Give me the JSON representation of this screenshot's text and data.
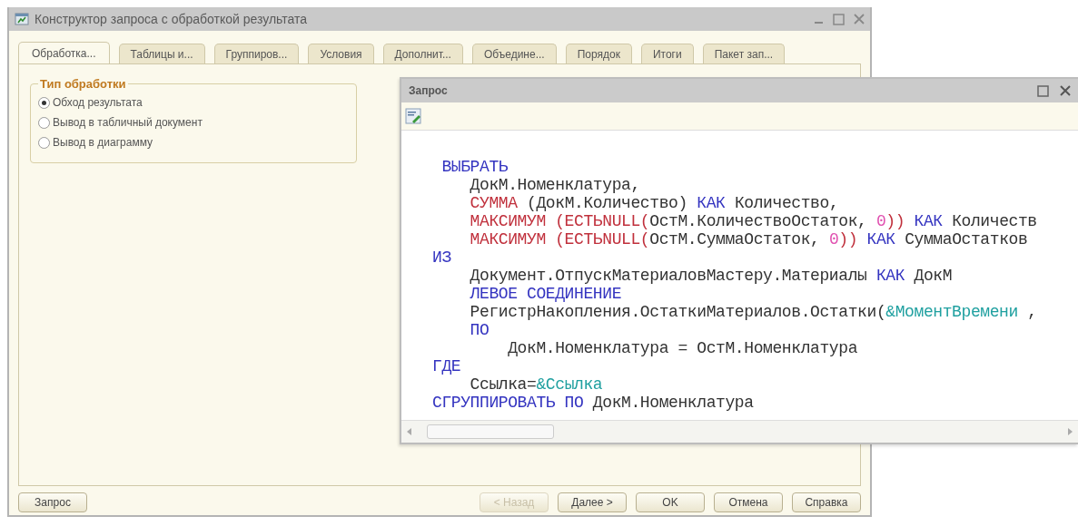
{
  "window": {
    "title": "Конструктор запроса с обработкой результата"
  },
  "tabs": [
    {
      "label": "Обработка...",
      "selected": true
    },
    {
      "label": "Таблицы и...",
      "selected": false
    },
    {
      "label": "Группиров...",
      "selected": false
    },
    {
      "label": "Условия",
      "selected": false
    },
    {
      "label": "Дополнит...",
      "selected": false
    },
    {
      "label": "Объедине...",
      "selected": false
    },
    {
      "label": "Порядок",
      "selected": false
    },
    {
      "label": "Итоги",
      "selected": false
    },
    {
      "label": "Пакет зап...",
      "selected": false
    }
  ],
  "processing_type": {
    "title": "Тип обработки",
    "options": [
      {
        "label": "Обход результата",
        "selected": true
      },
      {
        "label": "Вывод в табличный документ",
        "selected": false
      },
      {
        "label": "Вывод в диаграмму",
        "selected": false
      }
    ]
  },
  "query_window": {
    "title": "Запрос",
    "code_lines": [
      [
        {
          "kind": "keyword",
          "text": " ВЫБРАТЬ"
        }
      ],
      [
        {
          "kind": "text",
          "text": "    ДокМ.Номенклатура,"
        }
      ],
      [
        {
          "kind": "function",
          "text": "    СУММА"
        },
        {
          "kind": "text",
          "text": " (ДокМ.Количество) "
        },
        {
          "kind": "keyword",
          "text": "КАК"
        },
        {
          "kind": "text",
          "text": " Количество,"
        }
      ],
      [
        {
          "kind": "function",
          "text": "    МАКСИМУМ (ЕСТЬNULL("
        },
        {
          "kind": "text",
          "text": "ОстМ.КоличествоОстаток, "
        },
        {
          "kind": "number",
          "text": "0"
        },
        {
          "kind": "function",
          "text": ")) "
        },
        {
          "kind": "keyword",
          "text": "КАК"
        },
        {
          "kind": "text",
          "text": " Количеств"
        }
      ],
      [
        {
          "kind": "function",
          "text": "    МАКСИМУМ (ЕСТЬNULL("
        },
        {
          "kind": "text",
          "text": "ОстМ.СуммаОстаток, "
        },
        {
          "kind": "number",
          "text": "0"
        },
        {
          "kind": "function",
          "text": ")) "
        },
        {
          "kind": "keyword",
          "text": "КАК"
        },
        {
          "kind": "text",
          "text": " СуммаОстатков"
        }
      ],
      [
        {
          "kind": "keyword",
          "text": "ИЗ"
        }
      ],
      [
        {
          "kind": "text",
          "text": "    Документ.ОтпускМатериаловМастеру.Материалы "
        },
        {
          "kind": "keyword",
          "text": "КАК"
        },
        {
          "kind": "text",
          "text": " ДокМ"
        }
      ],
      [
        {
          "kind": "keyword",
          "text": "    ЛЕВОЕ СОЕДИНЕНИЕ"
        }
      ],
      [
        {
          "kind": "text",
          "text": "    РегистрНакопления.ОстаткиМатериалов.Остатки("
        },
        {
          "kind": "parameter",
          "text": "&МоментВремени"
        },
        {
          "kind": "text",
          "text": " ,"
        }
      ],
      [
        {
          "kind": "keyword",
          "text": "    ПО"
        }
      ],
      [
        {
          "kind": "text",
          "text": "        ДокМ.Номенклатура = ОстМ.Номенклатура"
        }
      ],
      [
        {
          "kind": "keyword",
          "text": "ГДЕ"
        }
      ],
      [
        {
          "kind": "text",
          "text": "    Ссылка="
        },
        {
          "kind": "parameter",
          "text": "&Ссылка"
        }
      ],
      [
        {
          "kind": "keyword",
          "text": "СГРУППИРОВАТЬ ПО"
        },
        {
          "kind": "text",
          "text": " ДокМ.Номенклатура"
        }
      ]
    ]
  },
  "bottom_bar": {
    "left_buttons": [
      {
        "label": "Запрос",
        "disabled": false
      }
    ],
    "right_buttons": [
      {
        "label": "< Назад",
        "disabled": true
      },
      {
        "label": "Далее >",
        "disabled": false
      },
      {
        "label": "OK",
        "disabled": false
      },
      {
        "label": "Отмена",
        "disabled": false
      },
      {
        "label": "Справка",
        "disabled": false
      }
    ]
  }
}
